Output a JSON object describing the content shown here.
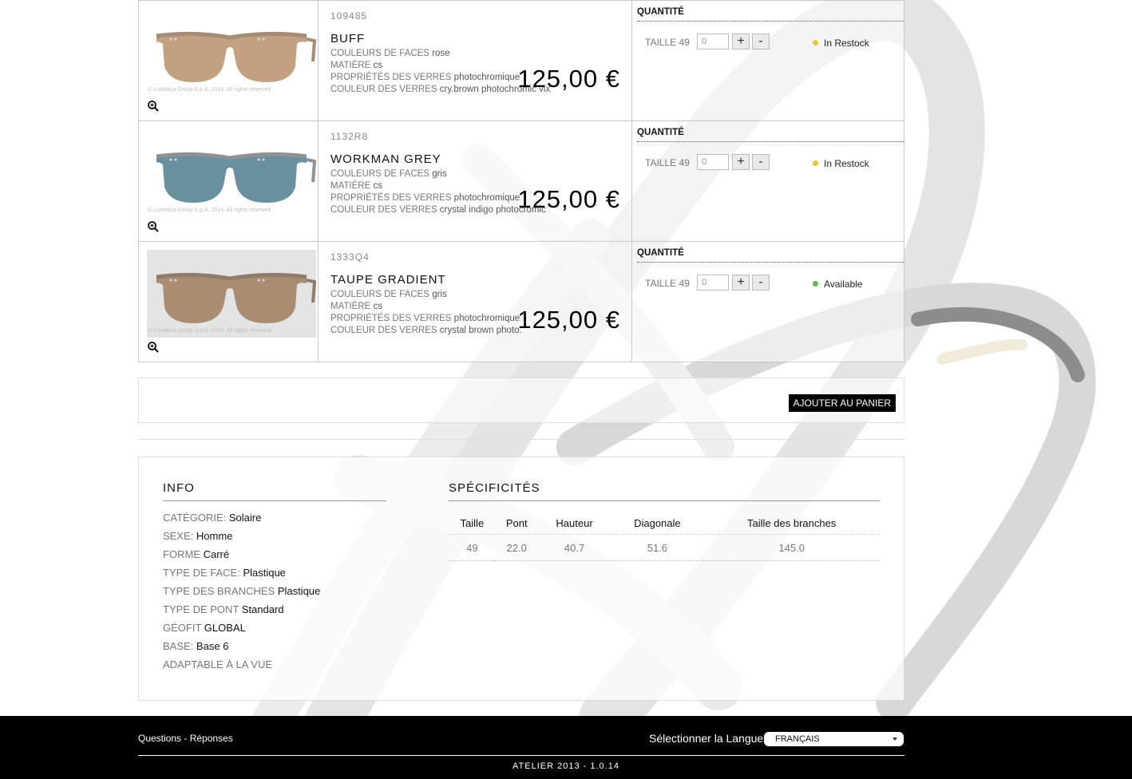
{
  "products": [
    {
      "ref": "109485",
      "name": "BUFF",
      "specs": [
        {
          "k": "COULEURS DE FACES",
          "v": "rose"
        },
        {
          "k": "MATIÈRE",
          "v": "cs"
        },
        {
          "k": "PROPRIÉTÉS DES VERRES",
          "v": "photochromique"
        },
        {
          "k": "COULEUR DES VERRES",
          "v": "cry.brown photochromic vix"
        }
      ],
      "price": "125,00 €",
      "qty_label": "QUANTITÉ",
      "size": "TAILLE 49",
      "qty_value": "0",
      "stock": "In Restock",
      "stock_color": "#e9c53a",
      "copyright": "© Luxottica Group S.p.A. 2014. All rights reserved",
      "lens_color": "#b78f6a",
      "frame_color": "#a38d78"
    },
    {
      "ref": "1132R8",
      "name": "WORKMAN GREY",
      "specs": [
        {
          "k": "COULEURS DE FACES",
          "v": "gris"
        },
        {
          "k": "MATIÈRE",
          "v": "cs"
        },
        {
          "k": "PROPRIÉTÉS DES VERRES",
          "v": "photochromique"
        },
        {
          "k": "COULEUR DES VERRES",
          "v": "crystal indigo photocromic"
        }
      ],
      "price": "125,00 €",
      "qty_label": "QUANTITÉ",
      "size": "TAILLE 49",
      "qty_value": "0",
      "stock": "In Restock",
      "stock_color": "#e9c53a",
      "copyright": "© Luxottica Group S.p.A. 2014. All rights reserved",
      "lens_color": "#4f7d8e",
      "frame_color": "#8e9295"
    },
    {
      "ref": "1333Q4",
      "name": "TAUPE GRADIENT",
      "specs": [
        {
          "k": "COULEURS DE FACES",
          "v": "gris"
        },
        {
          "k": "MATIÈRE",
          "v": "cs"
        },
        {
          "k": "PROPRIÉTÉS DES VERRES",
          "v": "photochromique"
        },
        {
          "k": "COULEUR DES VERRES",
          "v": "crystal brown photo."
        }
      ],
      "price": "125,00 €",
      "qty_label": "QUANTITÉ",
      "size": "TAILLE 49",
      "qty_value": "0",
      "stock": "Available",
      "stock_color": "#5cbf4a",
      "copyright": "© Luxottica Group S.p.A. 2014. All rights reserved",
      "lens_color": "#a07c5e",
      "frame_color": "#907c6c"
    }
  ],
  "cart_button": "AJOUTER AU PANIER",
  "info": {
    "title": "INFO",
    "attributes": [
      {
        "k": "CATÉGORIE:",
        "v": "Solaire"
      },
      {
        "k": "SEXE:",
        "v": "Homme"
      },
      {
        "k": "FORME",
        "v": "Carré"
      },
      {
        "k": "TYPE DE FACE:",
        "v": "Plastique"
      },
      {
        "k": "TYPE DES BRANCHES",
        "v": "Plastique"
      },
      {
        "k": "TYPE DE PONT",
        "v": "Standard"
      },
      {
        "k": "GÉOFIT",
        "v": "GLOBAL"
      },
      {
        "k": "BASE:",
        "v": "Base 6"
      },
      {
        "k": "ADAPTABLE À LA VUE",
        "v": ""
      }
    ]
  },
  "specifics": {
    "title": "SPÉCIFICITÉS",
    "headers": [
      "Taille",
      "Pont",
      "Hauteur",
      "Diagonale",
      "Taille des branches"
    ],
    "rows": [
      [
        "49",
        "22.0",
        "40.7",
        "51.6",
        "145.0"
      ]
    ]
  },
  "footer": {
    "faq": "Questions - Réponses",
    "language_label": "Sélectionner la Langue",
    "language_value": "FRANÇAIS",
    "version": "ATELIER 2013 - 1.0.14"
  }
}
